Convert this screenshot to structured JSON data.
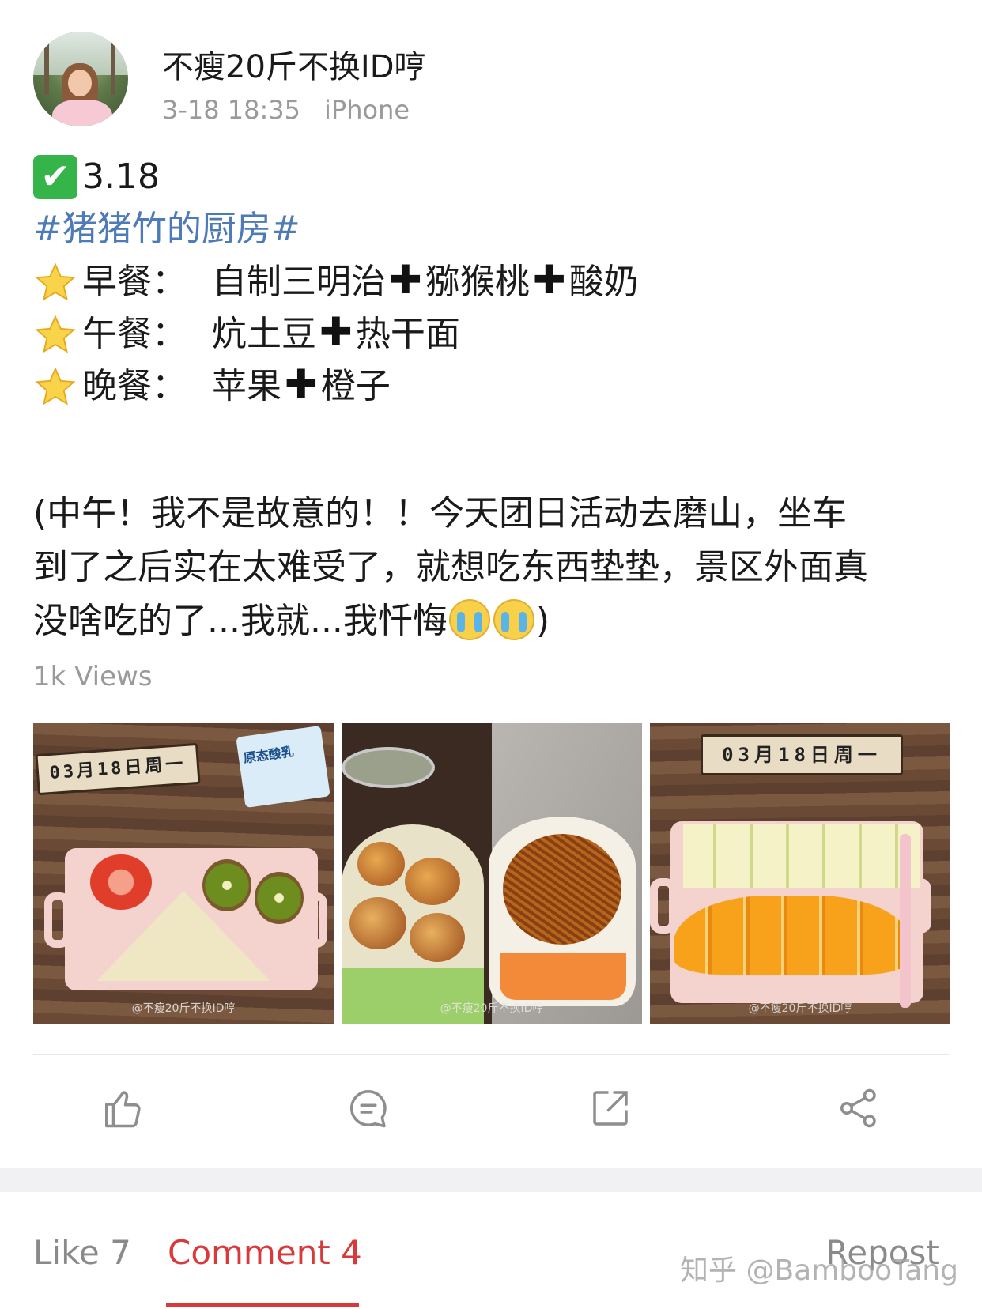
{
  "post": {
    "username": "不瘦20斤不换ID哼",
    "time": "3-18 18:35",
    "device": "iPhone",
    "check_mark": "✔",
    "date_tag": "3.18",
    "topic": "#猪猪竹的厨房#",
    "meals": [
      {
        "label": "早餐：",
        "items": [
          "自制三明治",
          "猕猴桃",
          "酸奶"
        ]
      },
      {
        "label": "午餐：",
        "items": [
          "炕土豆",
          "热干面"
        ]
      },
      {
        "label": "晚餐：",
        "items": [
          "苹果",
          "橙子"
        ]
      }
    ],
    "plus_sign": "✚",
    "note_lines": [
      "(中午！我不是故意的！！今天团日活动去磨山，坐车",
      "到了之后实在太难受了，就想吃东西垫垫，景区外面真",
      "没啥吃的了...我就...我忏悔"
    ],
    "note_end": ")",
    "views": "1k Views"
  },
  "photos": {
    "date_block_text": "03月18日周一",
    "yogurt_label": "原态酸乳",
    "watermark": "@不瘦20斤不换ID哼"
  },
  "actions": [
    "like-icon",
    "comment-icon",
    "forward-icon",
    "share-icon"
  ],
  "tabs": {
    "like": "Like 7",
    "comment": "Comment 4",
    "repost": "Repost"
  },
  "overlay": {
    "zhihu_watermark": "知乎 @BambooTang"
  },
  "colors": {
    "topic": "#4e7ab8",
    "active_tab": "#d83a3a",
    "meta": "#9a9a9a"
  }
}
